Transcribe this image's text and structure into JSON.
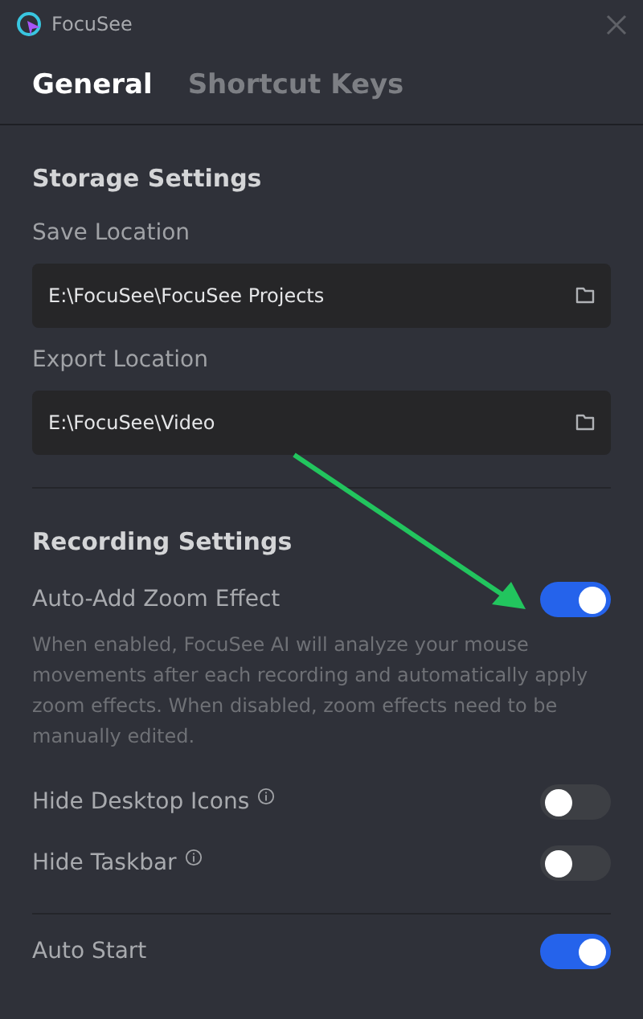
{
  "window": {
    "title": "FocuSee"
  },
  "tabs": [
    {
      "label": "General",
      "selected": true
    },
    {
      "label": "Shortcut Keys",
      "selected": false
    }
  ],
  "storage": {
    "heading": "Storage Settings",
    "fields": [
      {
        "label": "Save Location",
        "value": "E:\\FocuSee\\FocuSee Projects"
      },
      {
        "label": "Export Location",
        "value": "E:\\FocuSee\\Video"
      }
    ]
  },
  "recording": {
    "heading": "Recording Settings",
    "settings": [
      {
        "label": "Auto-Add Zoom Effect",
        "on": true,
        "info": false,
        "description": "When enabled, FocuSee AI will analyze your mouse movements after each recording and automatically apply zoom effects. When disabled, zoom effects need to be manually edited."
      },
      {
        "label": "Hide Desktop Icons",
        "on": false,
        "info": true
      },
      {
        "label": "Hide Taskbar",
        "on": false,
        "info": true
      }
    ]
  },
  "general": {
    "settings": [
      {
        "label": "Auto Start",
        "on": true
      }
    ]
  }
}
